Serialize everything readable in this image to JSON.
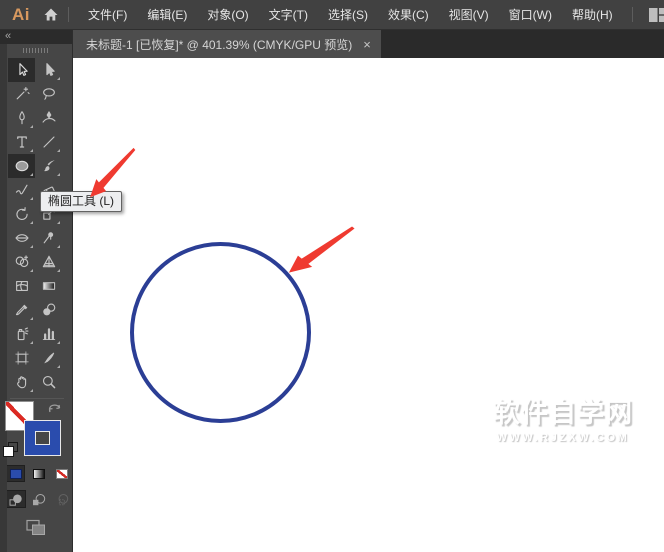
{
  "app": {
    "logo": "Ai"
  },
  "colors": {
    "ai_logo": "#D8995F",
    "circle_stroke": "#2B3E95",
    "stroke_swatch_blue": "#2A4CAD",
    "fill_button_blue": "#2A4CAD",
    "annotation_red": "#EF3A30"
  },
  "menu_bar": {
    "items": [
      {
        "name": "file",
        "label": "文件(F)"
      },
      {
        "name": "edit",
        "label": "编辑(E)"
      },
      {
        "name": "object",
        "label": "对象(O)"
      },
      {
        "name": "type",
        "label": "文字(T)"
      },
      {
        "name": "select",
        "label": "选择(S)"
      },
      {
        "name": "effect",
        "label": "效果(C)"
      },
      {
        "name": "view",
        "label": "视图(V)"
      },
      {
        "name": "window",
        "label": "窗口(W)"
      },
      {
        "name": "help",
        "label": "帮助(H)"
      }
    ]
  },
  "document_tab": {
    "title": "未标题-1 [已恢复]* @ 401.39% (CMYK/GPU 预览)",
    "close_glyph": "×"
  },
  "toolbar": {
    "collapse_icon": "«",
    "tools": [
      {
        "name": "selection-tool",
        "icon": "selection",
        "selected": true,
        "flyout": false
      },
      {
        "name": "direct-selection-tool",
        "icon": "direct-selection",
        "selected": false,
        "flyout": true
      },
      {
        "name": "magic-wand-tool",
        "icon": "magic-wand",
        "selected": false,
        "flyout": false
      },
      {
        "name": "lasso-tool",
        "icon": "lasso",
        "selected": false,
        "flyout": false
      },
      {
        "name": "pen-tool",
        "icon": "pen",
        "selected": false,
        "flyout": true
      },
      {
        "name": "curvature-tool",
        "icon": "curvature",
        "selected": false,
        "flyout": false
      },
      {
        "name": "type-tool",
        "icon": "type",
        "selected": false,
        "flyout": true
      },
      {
        "name": "line-segment-tool",
        "icon": "line",
        "selected": false,
        "flyout": true
      },
      {
        "name": "ellipse-tool",
        "icon": "ellipse",
        "selected": true,
        "flyout": true
      },
      {
        "name": "paintbrush-tool",
        "icon": "paintbrush",
        "selected": false,
        "flyout": true
      },
      {
        "name": "shaper-tool",
        "icon": "shaper",
        "selected": false,
        "flyout": true
      },
      {
        "name": "eraser-tool",
        "icon": "eraser",
        "selected": false,
        "flyout": true
      },
      {
        "name": "rotate-tool",
        "icon": "rotate",
        "selected": false,
        "flyout": true
      },
      {
        "name": "scale-tool",
        "icon": "scale",
        "selected": false,
        "flyout": true
      },
      {
        "name": "width-tool",
        "icon": "width",
        "selected": false,
        "flyout": true
      },
      {
        "name": "puppet-warp-tool",
        "icon": "puppet-pin",
        "selected": false,
        "flyout": true
      },
      {
        "name": "shape-builder-tool",
        "icon": "shape-builder",
        "selected": false,
        "flyout": true
      },
      {
        "name": "perspective-grid-tool",
        "icon": "perspective-grid",
        "selected": false,
        "flyout": true
      },
      {
        "name": "mesh-tool",
        "icon": "mesh",
        "selected": false,
        "flyout": false
      },
      {
        "name": "gradient-tool",
        "icon": "gradient",
        "selected": false,
        "flyout": false
      },
      {
        "name": "eyedropper-tool",
        "icon": "eyedropper",
        "selected": false,
        "flyout": true
      },
      {
        "name": "blend-tool",
        "icon": "blend",
        "selected": false,
        "flyout": false
      },
      {
        "name": "symbol-sprayer-tool",
        "icon": "symbol-sprayer",
        "selected": false,
        "flyout": true
      },
      {
        "name": "column-graph-tool",
        "icon": "column-graph",
        "selected": false,
        "flyout": true
      },
      {
        "name": "artboard-tool",
        "icon": "artboard",
        "selected": false,
        "flyout": false
      },
      {
        "name": "slice-tool",
        "icon": "slice",
        "selected": false,
        "flyout": true
      },
      {
        "name": "hand-tool",
        "icon": "hand",
        "selected": false,
        "flyout": true
      },
      {
        "name": "zoom-tool",
        "icon": "zoom",
        "selected": false,
        "flyout": false
      }
    ],
    "color_buttons": [
      {
        "name": "fill-color-button",
        "type": "color",
        "selected": true
      },
      {
        "name": "gradient-button",
        "type": "gradient",
        "selected": false
      },
      {
        "name": "none-button",
        "type": "none",
        "selected": false
      }
    ],
    "drawing_modes": [
      {
        "name": "draw-normal-mode-button",
        "mode": "normal",
        "selected": true,
        "disabled": false
      },
      {
        "name": "draw-behind-mode-button",
        "mode": "behind",
        "selected": false,
        "disabled": false
      },
      {
        "name": "draw-inside-mode-button",
        "mode": "inside",
        "selected": false,
        "disabled": true
      }
    ]
  },
  "tooltip": {
    "text": "椭圆工具 (L)"
  },
  "canvas": {
    "watermark": {
      "title": "软件自学网",
      "url": "WWW.RJZXW.COM"
    }
  }
}
